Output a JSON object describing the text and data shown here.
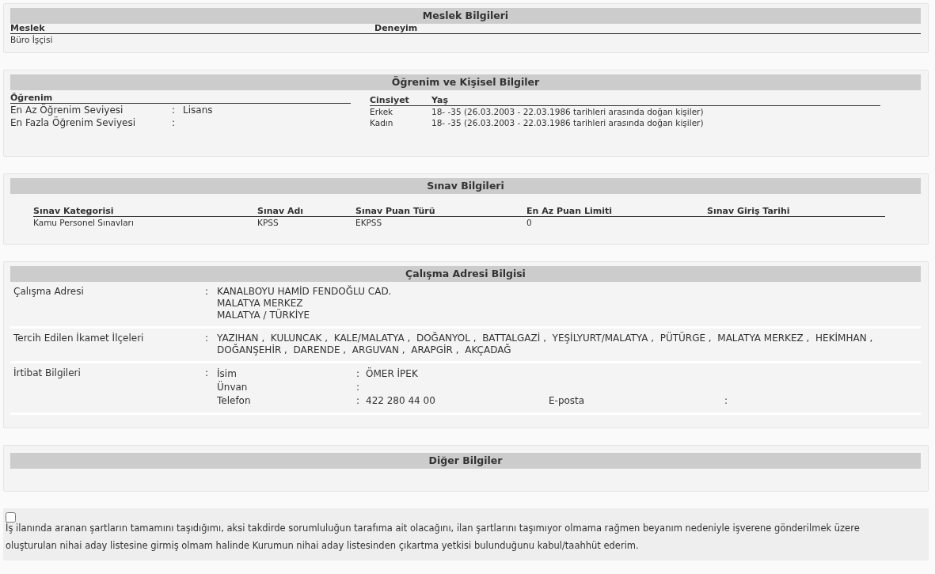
{
  "meslek": {
    "title": "Meslek Bilgileri",
    "columns": [
      "Meslek",
      "Deneyim"
    ],
    "rows": [
      [
        "Büro İşçisi",
        ""
      ]
    ]
  },
  "ogrenim": {
    "title": "Öğrenim ve Kişisel Bilgiler",
    "education_heading": "Öğrenim",
    "education": [
      {
        "label": "En Az Öğrenim Seviyesi",
        "sep": ":",
        "value": "Lisans"
      },
      {
        "label": "En Fazla Öğrenim Seviyesi",
        "sep": ":"
      }
    ],
    "personal_columns": [
      "Cinsiyet",
      "Yaş"
    ],
    "personal": [
      [
        "Erkek",
        "18- -35 (26.03.2003 - 22.03.1986 tarihleri arasında doğan kişiler)"
      ],
      [
        "Kadın",
        "18- -35 (26.03.2003 - 22.03.1986 tarihleri arasında doğan kişiler)"
      ]
    ]
  },
  "sinav": {
    "title": "Sınav Bilgileri",
    "columns": [
      "Sınav Kategorisi",
      "Sınav Adı",
      "Sınav Puan Türü",
      "En Az Puan Limiti",
      "Sınav Giriş Tarihi"
    ],
    "rows": [
      [
        "Kamu Personel Sınavları",
        "KPSS",
        "EKPSS",
        "0",
        ""
      ]
    ]
  },
  "adres": {
    "title": "Çalışma Adresi Bilgisi",
    "address": {
      "label": "Çalışma Adresi",
      "sep": ":",
      "lines": [
        "KANALBOYU HAMİD FENDOĞLU CAD.",
        "MALATYA MERKEZ",
        "MALATYA / TÜRKİYE"
      ]
    },
    "districts": {
      "label": "Tercih Edilen İkamet İlçeleri",
      "sep": ":",
      "value": "YAZIHAN ,  KULUNCAK ,  KALE/MALATYA ,  DOĞANYOL ,  BATTALGAZİ ,  YEŞİLYURT/MALATYA ,  PÜTÜRGE ,  MALATYA MERKEZ ,  HEKİMHAN ,  DOĞANŞEHİR ,  DARENDE ,  ARGUVAN ,  ARAPGİR ,  AKÇADAĞ"
    },
    "contact": {
      "label": "İrtibat Bilgileri",
      "sep": ":",
      "fields": [
        {
          "label": "İsim",
          "sep": ":",
          "value": "ÖMER İPEK"
        },
        {
          "label": "Ünvan",
          "sep": ":"
        },
        {
          "label": "Telefon",
          "sep": ":",
          "value": "422 280 44 00",
          "extra_label": "E-posta",
          "extra_sep": ":"
        }
      ]
    }
  },
  "diger": {
    "title": "Diğer Bilgiler"
  },
  "declaration": {
    "checked": false,
    "text": "İş ilanında aranan şartların tamamını taşıdığımı, aksi takdirde sorumluluğun tarafıma ait olacağını, ilan şartlarını taşımıyor olmama rağmen beyanım nedeniyle işverene gönderilmek üzere oluşturulan nihai aday listesine girmiş olmam halinde Kurumun nihai aday listesinden çıkartma yetkisi bulunduğunu kabul/taahhüt ederim."
  }
}
